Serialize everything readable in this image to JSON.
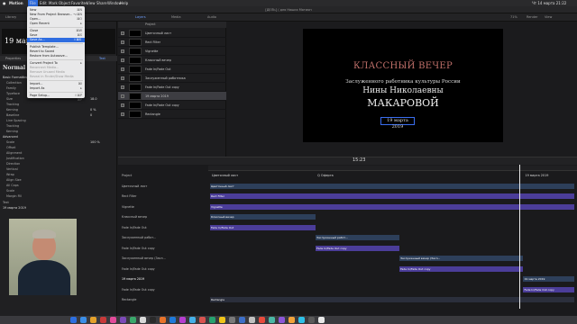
{
  "menubar": {
    "apple": "",
    "app": "Motion",
    "items": [
      "File",
      "Edit",
      "Mark",
      "Object",
      "Favorites",
      "View",
      "Share",
      "Window",
      "Help"
    ],
    "right": "Чт 14 марта  21:22"
  },
  "window_title": "[ДЕЛЬ] / для Наших Мотион",
  "tabs": [
    "Library",
    "Inspector",
    "Layers",
    "Media",
    "Audio"
  ],
  "zoom": "71%",
  "render": "Render",
  "view": "View",
  "file_menu": {
    "items": [
      {
        "label": "New",
        "shortcut": "⌘N",
        "disabled": false
      },
      {
        "label": "New From Project Browser...",
        "shortcut": "⌥⌘N",
        "disabled": false
      },
      {
        "label": "Open...",
        "shortcut": "⌘O",
        "disabled": false
      },
      {
        "label": "Open Recent",
        "shortcut": "▸",
        "disabled": false
      },
      {
        "label": "Close",
        "shortcut": "⌘W",
        "disabled": false
      },
      {
        "label": "Save",
        "shortcut": "⌘S",
        "disabled": false
      },
      {
        "label": "Save As...",
        "shortcut": "⇧⌘S",
        "disabled": false
      },
      {
        "label": "Publish Template...",
        "shortcut": "",
        "disabled": false
      },
      {
        "label": "Revert to Saved",
        "shortcut": "",
        "disabled": false
      },
      {
        "label": "Restore from Autosave...",
        "shortcut": "",
        "disabled": false
      },
      {
        "label": "Convert Project To",
        "shortcut": "▸",
        "disabled": false
      },
      {
        "label": "Reconnect Media...",
        "shortcut": "",
        "disabled": true
      },
      {
        "label": "Remove Unused Media",
        "shortcut": "",
        "disabled": true
      },
      {
        "label": "Reveal in Finder/Show Media",
        "shortcut": "",
        "disabled": true
      },
      {
        "label": "Import...",
        "shortcut": "⌘I",
        "disabled": false
      },
      {
        "label": "Import As",
        "shortcut": "▸",
        "disabled": false
      },
      {
        "label": "Page Setup...",
        "shortcut": "⇧⌘P",
        "disabled": false
      },
      {
        "label": "Print...",
        "shortcut": "⌘P",
        "disabled": false
      }
    ]
  },
  "inspector": {
    "preview_text": "19 марта 2",
    "subtabs": [
      "Properties",
      "Behaviors",
      "Filters",
      "Text"
    ],
    "section_label": "Normal",
    "fields": [
      "Basic Formatting",
      "Collection",
      "Family",
      "Typeface",
      "Size",
      "Tracking",
      "Kerning",
      "Baseline",
      "Line Spacing",
      "Tracking",
      "Kerning",
      "Advanced",
      "Scale",
      "Offset",
      "Alignment",
      "Justification",
      "Direction",
      "Vertical",
      "Wrap",
      "Align Size",
      "All Caps",
      "Scale",
      "Margin Fill"
    ],
    "size_value": "18.0",
    "tracking_value": "0 %",
    "kerning_value": "0",
    "scale_value": "100 %",
    "bottom_label": "Text",
    "bottom_value": "19 марта 2019"
  },
  "layers": {
    "header": "Project",
    "rows": [
      {
        "name": "Цветочный лист",
        "selected": false
      },
      {
        "name": "Rect Filter",
        "selected": false
      },
      {
        "name": "Vignette",
        "selected": false
      },
      {
        "name": "Классный вечер",
        "selected": false
      },
      {
        "name": "Fade In/Fade Out",
        "selected": false
      },
      {
        "name": "Заслуженный работника",
        "selected": false
      },
      {
        "name": "Fade In/Fade Out copy",
        "selected": false
      },
      {
        "name": "19 марта 2019",
        "selected": true
      },
      {
        "name": "Fade In/Fade Out copy",
        "selected": false
      },
      {
        "name": "Rectangle",
        "selected": false
      }
    ]
  },
  "video": {
    "title": "КЛАССНЫЙ ВЕЧЕР",
    "subtitle": "Заслуженного работника культуры России",
    "name1": "Нины Николаевны",
    "name2": "МАКАРОВОЙ",
    "date": "19 марта 2019"
  },
  "timeline": {
    "timecode": "15:23",
    "rows": [
      "Project",
      "Цветочный лист",
      "Rect Filter",
      "Vignette",
      "Классный вечер",
      "Fade In/Fade Out",
      "Заслуженный работ...",
      "Fade In/Fade Out copy",
      "Заслуженный вечер (Засл...",
      "Fade In/Fade Out copy",
      "19 марта 2019",
      "Fade In/Fade Out copy",
      "Rectangle"
    ],
    "clips": [
      {
        "label": "Цветочный лист",
        "class": "cb",
        "row": 0,
        "start": 0,
        "end": 1
      },
      {
        "label": "Rect Filter",
        "class": "cp",
        "row": 1,
        "start": 0,
        "end": 1
      },
      {
        "label": "Vignette",
        "class": "cp",
        "row": 2,
        "start": 0,
        "end": 1
      },
      {
        "label": "Классный вечер",
        "class": "cb",
        "row": 3,
        "start": 0,
        "end": 0.29
      },
      {
        "label": "Fade In/Fade Out",
        "class": "cp",
        "row": 4,
        "start": 0,
        "end": 0.29
      },
      {
        "label": "Заслуженный работ...",
        "class": "cb",
        "row": 5,
        "start": 0.29,
        "end": 0.52
      },
      {
        "label": "Fade In/Fade Out copy",
        "class": "cp",
        "row": 6,
        "start": 0.29,
        "end": 0.52
      },
      {
        "label": "Заслуженный вечер (Засл...",
        "class": "cb",
        "row": 7,
        "start": 0.52,
        "end": 0.86
      },
      {
        "label": "Fade In/Fade Out copy",
        "class": "cp",
        "row": 8,
        "start": 0.52,
        "end": 0.86
      },
      {
        "label": "19 марта 2019",
        "class": "cb",
        "row": 9,
        "start": 0.86,
        "end": 1
      },
      {
        "label": "Fade In/Fade Out copy",
        "class": "cp",
        "row": 10,
        "start": 0.86,
        "end": 1
      },
      {
        "label": "Rectangle",
        "class": "cd",
        "row": 11,
        "start": 0,
        "end": 1
      }
    ],
    "group_labels": [
      "Цветочный лист",
      "Q Оферта",
      "19 марта 2019"
    ]
  },
  "dock_colors": [
    "#2d6fe0",
    "#3b8ee8",
    "#e4a12a",
    "#c93a3a",
    "#e34b9a",
    "#7c4ab8",
    "#3aa86b",
    "#d9d9d9",
    "#2a2a2a",
    "#e8732a",
    "#1f7ad9",
    "#b63dd0",
    "#45b0e8",
    "#d9534f",
    "#26a26f",
    "#f0c419",
    "#7a7a7a",
    "#3e6fc8",
    "#c0c0c0",
    "#e84b3c",
    "#4ab8a5",
    "#8c56d8",
    "#f2a33a",
    "#2ec0e8",
    "#5a5a5a",
    "#e8e8e8"
  ]
}
